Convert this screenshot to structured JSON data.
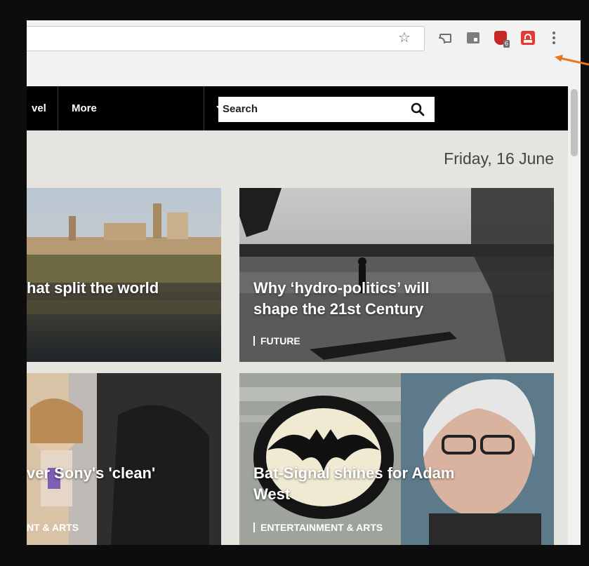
{
  "browser": {
    "star_icon": "☆"
  },
  "site_nav": {
    "travel_label": "vel",
    "more_label": "More",
    "search_placeholder": "Search"
  },
  "date": "Friday, 16 June",
  "cards": [
    {
      "headline_line1": "hat split the world",
      "headline_line2": "",
      "tag": ""
    },
    {
      "headline_line1": "Why ‘hydro-politics’ will",
      "headline_line2": "shape the 21st Century",
      "tag": "FUTURE"
    },
    {
      "headline_line1": "ver Sony's 'clean'",
      "headline_line2": "",
      "tag": "NT & ARTS"
    },
    {
      "headline_line1": "Bat-Signal shines for Adam",
      "headline_line2": "West",
      "tag": "ENTERTAINMENT & ARTS"
    }
  ],
  "colors": {
    "nav_bg": "#000000",
    "accent_arrow": "#e8761f",
    "page_bg": "#e6e4de"
  }
}
